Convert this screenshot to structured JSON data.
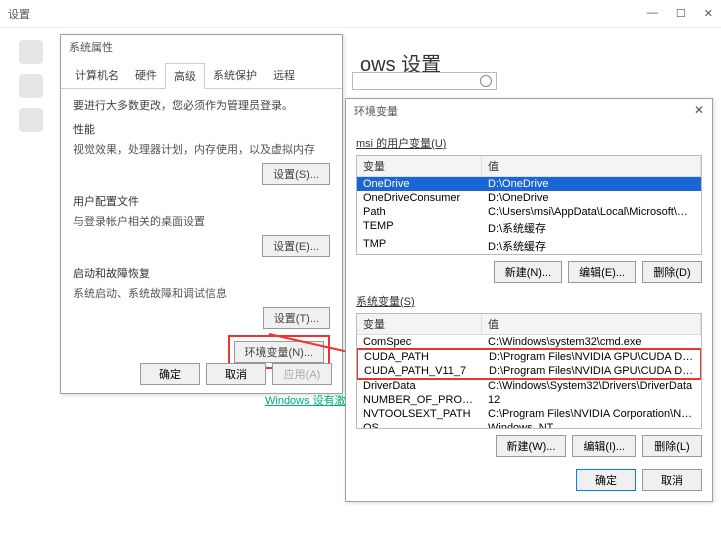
{
  "main": {
    "title": "设置",
    "header": "ows 设置",
    "search_placeholder": ""
  },
  "winbtns": {
    "min": "—",
    "max": "☐",
    "close": "✕"
  },
  "sidebar": {
    "items": [
      "home",
      "display",
      "sound"
    ]
  },
  "sys": {
    "title": "系统属性",
    "tabs": [
      "计算机名",
      "硬件",
      "高级",
      "系统保护",
      "远程"
    ],
    "active_tab": 2,
    "notice": "要进行大多数更改，您必须作为管理员登录。",
    "perf": {
      "title": "性能",
      "desc": "视觉效果，处理器计划，内存使用，以及虚拟内存",
      "btn": "设置(S)..."
    },
    "profile": {
      "title": "用户配置文件",
      "desc": "与登录帐户相关的桌面设置",
      "btn": "设置(E)..."
    },
    "startup": {
      "title": "启动和故障恢复",
      "desc": "系统启动、系统故障和调试信息",
      "btn": "设置(T)..."
    },
    "env_btn": "环境变量(N)...",
    "footer": {
      "ok": "确定",
      "cancel": "取消",
      "apply": "应用(A)"
    }
  },
  "link": "Windows 设有激活...",
  "env": {
    "title": "环境变量",
    "user_label": "msi 的用户变量(U)",
    "col1": "变量",
    "col2": "值",
    "user_rows": [
      {
        "name": "OneDrive",
        "value": "D:\\OneDrive",
        "selected": true
      },
      {
        "name": "OneDriveConsumer",
        "value": "D:\\OneDrive"
      },
      {
        "name": "Path",
        "value": "C:\\Users\\msi\\AppData\\Local\\Microsoft\\WindowsApps;D:\\Ban..."
      },
      {
        "name": "TEMP",
        "value": "D:\\系统缓存"
      },
      {
        "name": "TMP",
        "value": "D:\\系统缓存"
      }
    ],
    "user_btns": {
      "new": "新建(N)...",
      "edit": "编辑(E)...",
      "delete": "删除(D)"
    },
    "sys_label": "系统变量(S)",
    "sys_rows": [
      {
        "name": "ComSpec",
        "value": "C:\\Windows\\system32\\cmd.exe"
      },
      {
        "name": "CUDA_PATH",
        "value": "D:\\Program Files\\NVIDIA GPU\\CUDA Development",
        "boxed": true
      },
      {
        "name": "CUDA_PATH_V11_7",
        "value": "D:\\Program Files\\NVIDIA GPU\\CUDA Development",
        "boxed": true
      },
      {
        "name": "DriverData",
        "value": "C:\\Windows\\System32\\Drivers\\DriverData"
      },
      {
        "name": "NUMBER_OF_PROCESSORS",
        "value": "12"
      },
      {
        "name": "NVTOOLSEXT_PATH",
        "value": "C:\\Program Files\\NVIDIA Corporation\\NvToolsExt\\"
      },
      {
        "name": "OS",
        "value": "Windows_NT"
      }
    ],
    "sys_btns": {
      "new": "新建(W)...",
      "edit": "编辑(I)...",
      "delete": "删除(L)"
    },
    "footer": {
      "ok": "确定",
      "cancel": "取消"
    }
  }
}
